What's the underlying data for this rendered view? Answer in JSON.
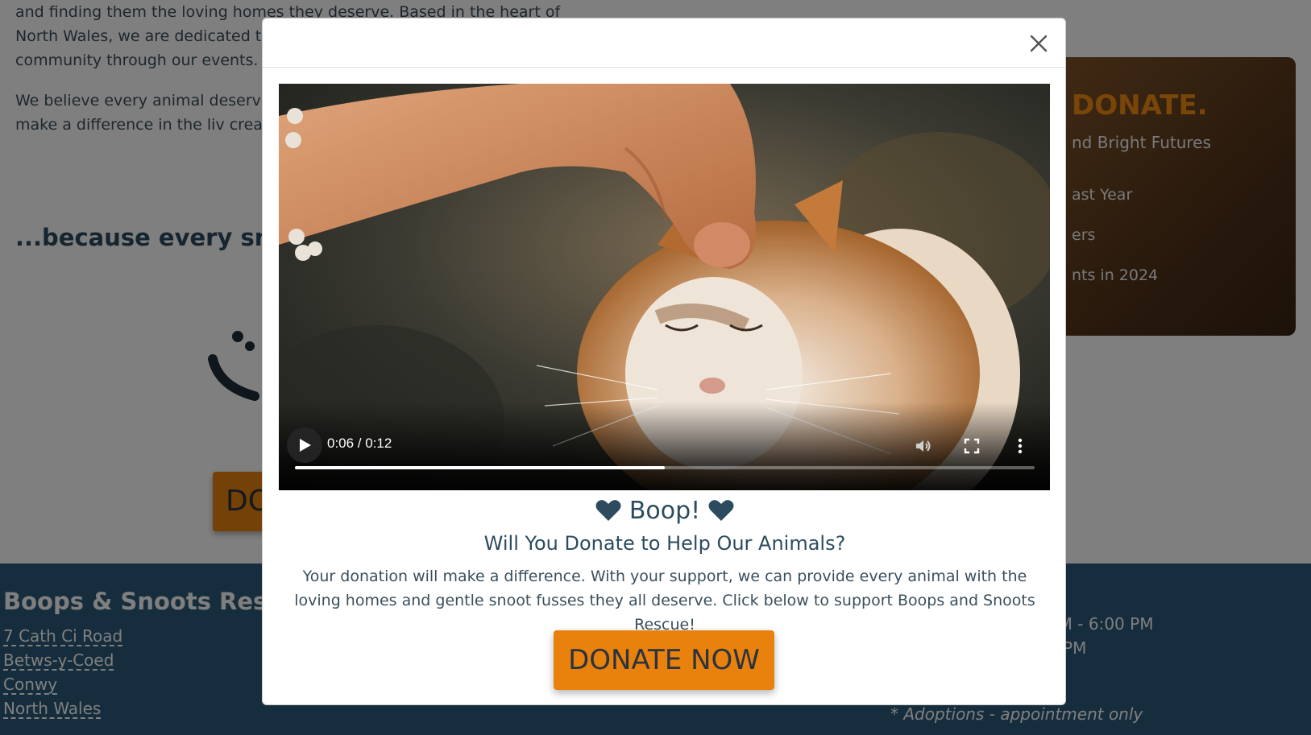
{
  "intro": {
    "paragraph1": "and finding them the loving homes they deserve. Based in the heart of North Wales, we are dedicated to rescu We also promote responsible pet community through our events.",
    "paragraph2": "We believe every animal deserve kindness. Whether you're looking helps make a difference in the liv create a better world for animals",
    "tagline": "...because every snoo"
  },
  "promo": {
    "heading": "DONATE.",
    "subheading": "nd Bright Futures",
    "stats": [
      "ast Year",
      "ers",
      "nts in 2024"
    ]
  },
  "background_button": {
    "label": "DO"
  },
  "footer": {
    "title": "Boops & Snoots Rescu",
    "address": [
      "7 Cath Ci Road",
      "Betws-y-Coed",
      "Conwy",
      "North Wales"
    ],
    "hours": [
      "AM - 6:00 PM",
      "0 PM"
    ],
    "note": "* Adoptions - appointment only"
  },
  "modal": {
    "close_icon": "close-icon",
    "video": {
      "current_time": "0:06",
      "duration": "0:12",
      "timecode": "0:06 / 0:12",
      "progress_fraction": 0.5,
      "icons": [
        "play-icon",
        "volume-icon",
        "fullscreen-icon",
        "more-options-icon"
      ]
    },
    "title": "Boop!",
    "title_icon": "heart-icon",
    "question": "Will You Donate to Help Our Animals?",
    "description": "Your donation will make a difference. With your support, we can provide every animal with the loving homes and gentle snoot fusses they all deserve. Click below to support Boops and Snoots Rescue!",
    "cta_label": "DONATE NOW"
  },
  "colors": {
    "accent": "#e8820c",
    "text": "#2c4b5e",
    "footer_bg": "#2d5a7b",
    "overlay": "rgba(0,0,0,0.5)"
  }
}
